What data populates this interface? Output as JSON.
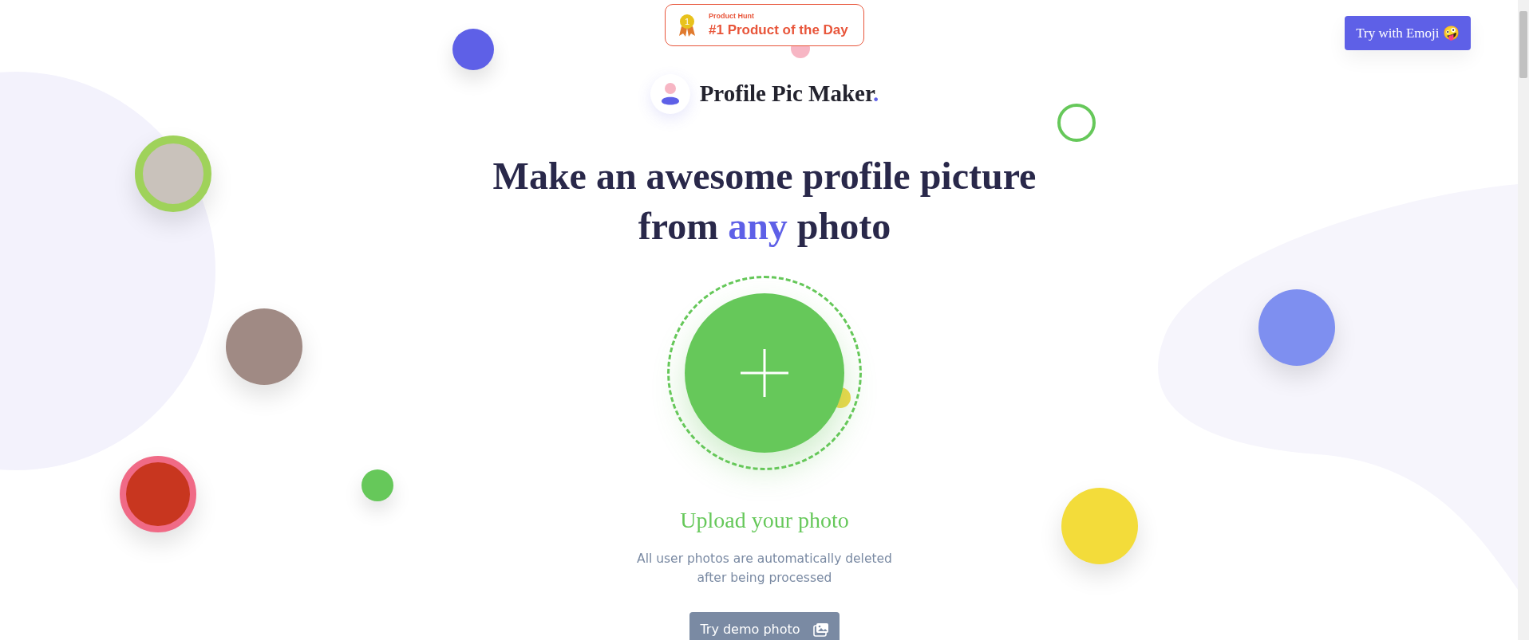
{
  "badge": {
    "eyebrow": "Product Hunt",
    "title": "#1 Product of the Day",
    "rank": "1"
  },
  "emoji_button": {
    "label": "Try with Emoji 🤪"
  },
  "brand": {
    "name": "Profile Pic Maker",
    "dot": "."
  },
  "headline_lines": [
    [
      {
        "text": "Make an awesome profile picture",
        "highlight": false
      }
    ],
    [
      {
        "text": "from ",
        "highlight": false
      },
      {
        "text": "any",
        "highlight": true
      },
      {
        "text": " photo",
        "highlight": false
      }
    ]
  ],
  "upload": {
    "label": "Upload your photo",
    "note": "All user photos are automatically deleted after being processed"
  },
  "demo_button": {
    "label": "Try demo photo"
  }
}
